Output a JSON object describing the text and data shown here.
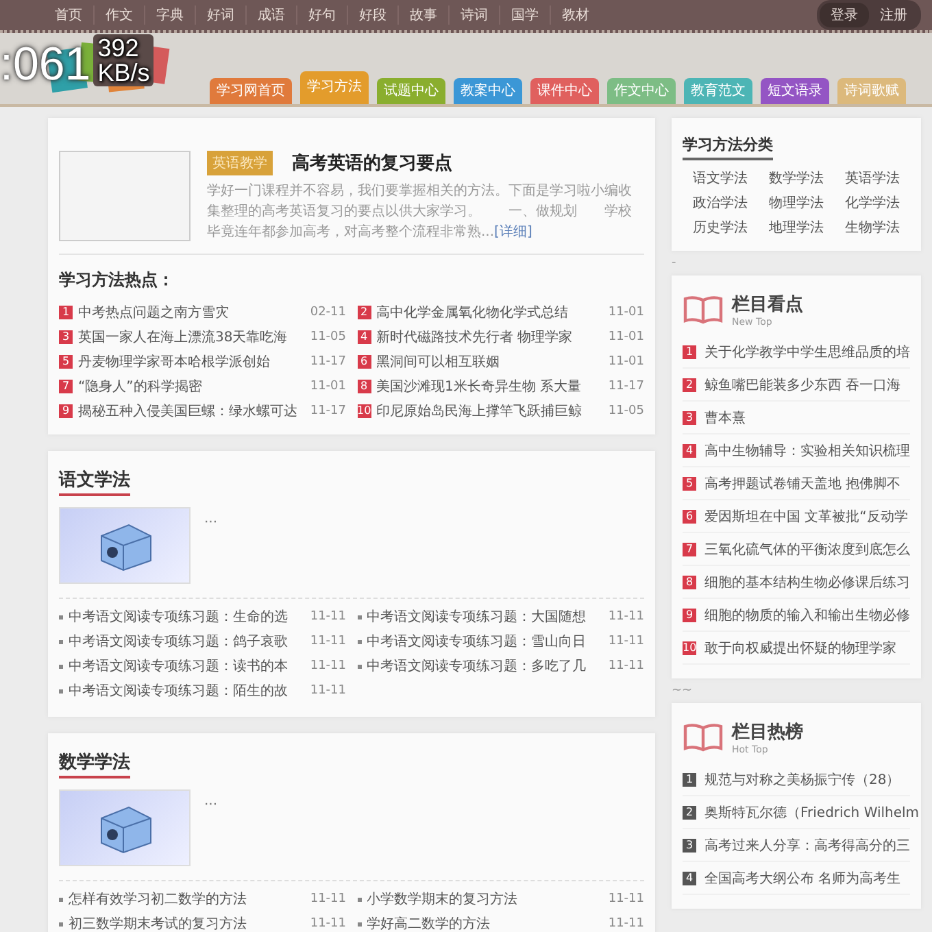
{
  "top_nav": {
    "links": [
      "首页",
      "作文",
      "字典",
      "好词",
      "成语",
      "好句",
      "好段",
      "故事",
      "诗词",
      "国学",
      "教材"
    ],
    "auth": [
      {
        "label": "登录",
        "selected": true
      },
      {
        "label": "注册",
        "selected": false
      }
    ]
  },
  "overlay": {
    "clock": ":061",
    "speed": "392",
    "unit": "KB/s"
  },
  "tabs": [
    {
      "label": "学习网首页",
      "color": "#e07a3c",
      "selected": false
    },
    {
      "label": "学习方法",
      "color": "#e39c2c",
      "selected": true
    },
    {
      "label": "试题中心",
      "color": "#8aae2e",
      "selected": false
    },
    {
      "label": "教案中心",
      "color": "#3b97d6",
      "selected": false
    },
    {
      "label": "课件中心",
      "color": "#e0605e",
      "selected": false
    },
    {
      "label": "作文中心",
      "color": "#7dbd85",
      "selected": false
    },
    {
      "label": "教育范文",
      "color": "#4db5b5",
      "selected": false
    },
    {
      "label": "短文语录",
      "color": "#9455c4",
      "selected": false
    },
    {
      "label": "诗词歌赋",
      "color": "#dcb97c",
      "selected": false
    }
  ],
  "featured": {
    "tag": "英语教学",
    "title": "高考英语的复习要点",
    "summary": "学好一门课程并不容易，我们要掌握相关的方法。下面是学习啦小编收集整理的高考英语复习的要点以供大家学习。　　一、做规划　　学校毕竟连年都参加高考，对高考整个流程非常熟...",
    "more": "[详细]"
  },
  "hot": {
    "title": "学习方法热点：",
    "items": [
      {
        "rank": "1",
        "title": "中考热点问题之南方雪灾",
        "date": "02-11"
      },
      {
        "rank": "2",
        "title": "高中化学金属氧化物化学式总结",
        "date": "11-01"
      },
      {
        "rank": "3",
        "title": "英国一家人在海上漂流38天靠吃海",
        "date": "11-05"
      },
      {
        "rank": "4",
        "title": "新时代磁路技术先行者 物理学家",
        "date": "11-01"
      },
      {
        "rank": "5",
        "title": "丹麦物理学家哥本哈根学派创始",
        "date": "11-17"
      },
      {
        "rank": "6",
        "title": "黑洞间可以相互联姻",
        "date": "11-01"
      },
      {
        "rank": "7",
        "title": "“隐身人”的科学揭密",
        "date": "11-01"
      },
      {
        "rank": "8",
        "title": "美国沙滩现1米长奇异生物 系大量",
        "date": "11-17"
      },
      {
        "rank": "9",
        "title": "揭秘五种入侵美国巨螺：绿水螺可达",
        "date": "11-17"
      },
      {
        "rank": "10",
        "title": "印尼原始岛民海上撑竿飞跃捕巨鲸",
        "date": "11-05"
      }
    ]
  },
  "sections": [
    {
      "title": "语文学法",
      "ellipsis": "···",
      "items": [
        {
          "title": "中考语文阅读专项练习题：生命的选",
          "date": "11-11"
        },
        {
          "title": "中考语文阅读专项练习题：大国随想",
          "date": "11-11"
        },
        {
          "title": "中考语文阅读专项练习题：鸽子哀歌",
          "date": "11-11"
        },
        {
          "title": "中考语文阅读专项练习题：雪山向日",
          "date": "11-11"
        },
        {
          "title": "中考语文阅读专项练习题：读书的本",
          "date": "11-11"
        },
        {
          "title": "中考语文阅读专项练习题：多吃了几",
          "date": "11-11"
        },
        {
          "title": "中考语文阅读专项练习题：陌生的故",
          "date": "11-11"
        }
      ]
    },
    {
      "title": "数学学法",
      "ellipsis": "···",
      "items": [
        {
          "title": "怎样有效学习初二数学的方法",
          "date": "11-11"
        },
        {
          "title": "小学数学期末的复习方法",
          "date": "11-11"
        },
        {
          "title": "初三数学期末考试的复习方法",
          "date": "11-11"
        },
        {
          "title": "学好高二数学的方法",
          "date": "11-11"
        }
      ]
    }
  ],
  "categories": {
    "title": "学习方法分类",
    "items": [
      "语文学法",
      "数学学法",
      "英语学法",
      "政治学法",
      "物理学法",
      "化学学法",
      "历史学法",
      "地理学法",
      "生物学法"
    ]
  },
  "news_panels": [
    {
      "kind": "new",
      "note_above": "-",
      "title": "栏目看点",
      "subtitle": "New Top",
      "items": [
        {
          "rank": "1",
          "title": "关于化学教学中学生思维品质的培"
        },
        {
          "rank": "2",
          "title": "鲸鱼嘴巴能装多少东西 吞一口海"
        },
        {
          "rank": "3",
          "title": "曹本熹"
        },
        {
          "rank": "4",
          "title": "高中生物辅导：实验相关知识梳理"
        },
        {
          "rank": "5",
          "title": "高考押题试卷铺天盖地 抱佛脚不"
        },
        {
          "rank": "6",
          "title": "爱因斯坦在中国 文革被批“反动学"
        },
        {
          "rank": "7",
          "title": "三氧化硫气体的平衡浓度到底怎么"
        },
        {
          "rank": "8",
          "title": "细胞的基本结构生物必修课后练习"
        },
        {
          "rank": "9",
          "title": "细胞的物质的输入和输出生物必修"
        },
        {
          "rank": "10",
          "title": "敢于向权威提出怀疑的物理学家"
        }
      ]
    },
    {
      "kind": "hot",
      "note_above": "~~",
      "title": "栏目热榜",
      "subtitle": "Hot Top",
      "items": [
        {
          "rank": "1",
          "title": "规范与对称之美杨振宁传（28）"
        },
        {
          "rank": "2",
          "title": "奥斯特瓦尔德（Friedrich Wilhelm"
        },
        {
          "rank": "3",
          "title": "高考过来人分享：高考得高分的三"
        },
        {
          "rank": "4",
          "title": "全国高考大纲公布 名师为高考生"
        }
      ]
    }
  ]
}
